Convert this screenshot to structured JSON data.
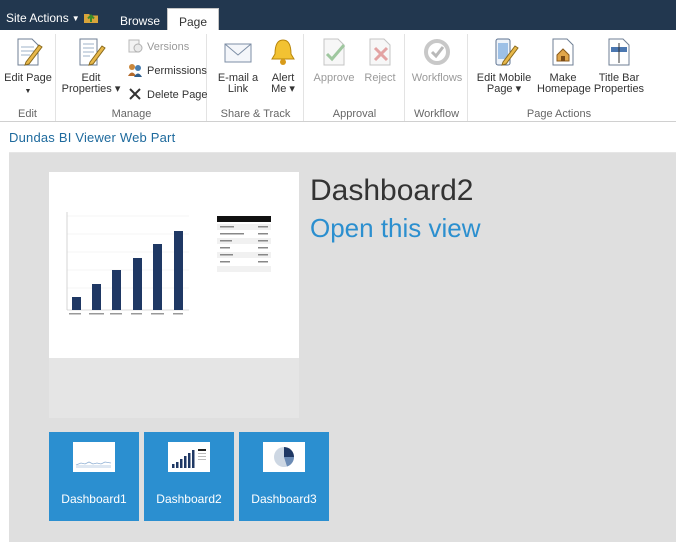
{
  "topbar": {
    "site_actions": "Site Actions",
    "tabs": [
      "Browse",
      "Page"
    ]
  },
  "ribbon": {
    "groups": {
      "edit": "Edit",
      "manage": "Manage",
      "share": "Share & Track",
      "approval": "Approval",
      "workflow": "Workflow",
      "page_actions": "Page Actions"
    },
    "edit_page": "Edit Page",
    "edit_properties": [
      "Edit",
      "Properties"
    ],
    "versions": "Versions",
    "permissions": "Permissions",
    "delete_page": "Delete Page",
    "email_link": [
      "E-mail a",
      "Link"
    ],
    "alert_me": [
      "Alert",
      "Me"
    ],
    "approve": "Approve",
    "reject": "Reject",
    "workflows": "Workflows",
    "edit_mobile": [
      "Edit Mobile",
      "Page"
    ],
    "make_homepage": [
      "Make",
      "Homepage"
    ],
    "title_bar": [
      "Title Bar",
      "Properties"
    ]
  },
  "webpart": {
    "title": "Dundas BI Viewer Web Part",
    "dashboard_title": "Dashboard2",
    "open_link": "Open this view"
  },
  "tiles": [
    {
      "label": "Dashboard1"
    },
    {
      "label": "Dashboard2"
    },
    {
      "label": "Dashboard3"
    }
  ],
  "colors": {
    "topbar": "#22374f",
    "accent": "#2b8fd0",
    "bar": "#1f3864"
  }
}
